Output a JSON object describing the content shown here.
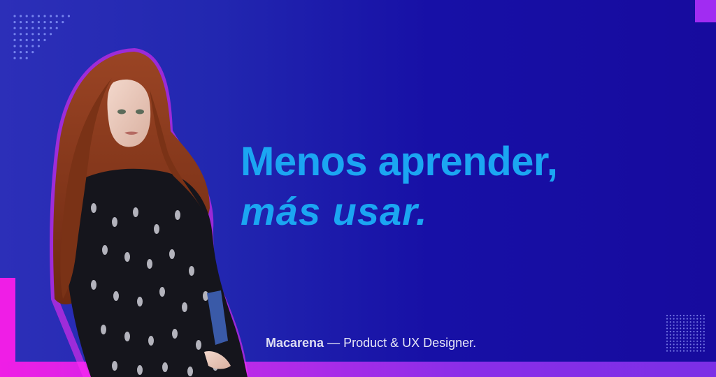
{
  "headline": {
    "line1": "Menos aprender,",
    "line2": "más usar."
  },
  "caption": {
    "name": "Macarena",
    "separator": " — ",
    "role": "Product & UX Designer."
  },
  "colors": {
    "background_start": "#2c2fb8",
    "background_end": "#170b9e",
    "headline": "#1ba6f2",
    "magenta_accent": "#ef1ee6",
    "purple_accent": "#a12cf2",
    "portrait_outline": "#ff2bf5",
    "caption_text": "#e6e6f6"
  },
  "portrait": {
    "icon": "person-portrait-icon",
    "hair_color": "#8a3a1c",
    "blouse_color": "#15151c"
  }
}
